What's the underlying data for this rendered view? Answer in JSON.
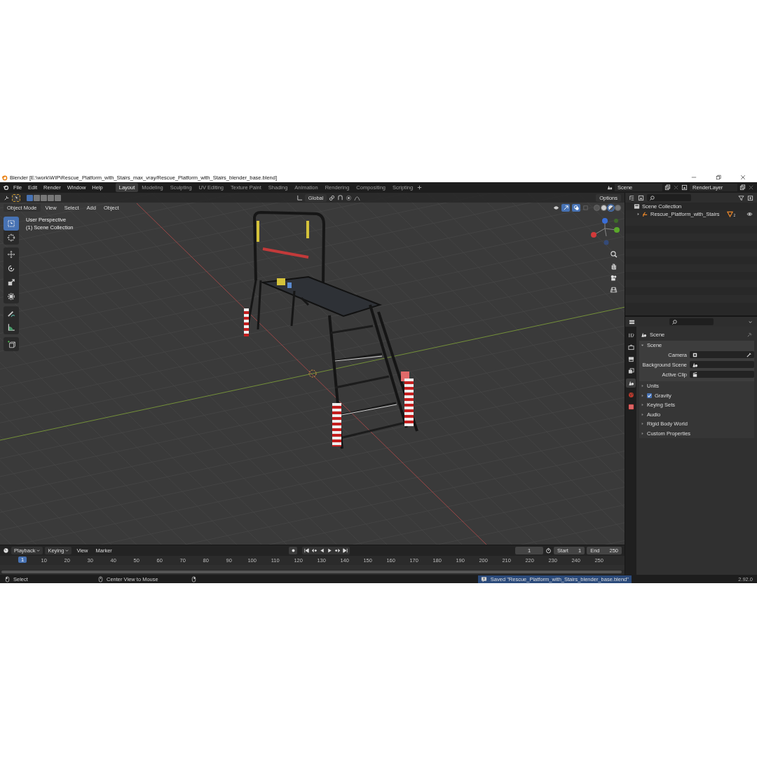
{
  "window": {
    "title": "Blender [E:\\work\\WIP\\Rescue_Platform_with_Stairs_max_vray/Rescue_Platform_with_Stairs_blender_base.blend]"
  },
  "menu": [
    "File",
    "Edit",
    "Render",
    "Window",
    "Help"
  ],
  "workspaces": [
    {
      "label": "Layout",
      "selected": true
    },
    {
      "label": "Modeling",
      "selected": false
    },
    {
      "label": "Sculpting",
      "selected": false
    },
    {
      "label": "UV Editing",
      "selected": false
    },
    {
      "label": "Texture Paint",
      "selected": false
    },
    {
      "label": "Shading",
      "selected": false
    },
    {
      "label": "Animation",
      "selected": false
    },
    {
      "label": "Rendering",
      "selected": false
    },
    {
      "label": "Compositing",
      "selected": false
    },
    {
      "label": "Scripting",
      "selected": false
    }
  ],
  "scene": "Scene",
  "view_layer": "RenderLayer",
  "viewport": {
    "orientation": "Global",
    "options": "Options",
    "mode": "Object Mode",
    "menus": [
      "View",
      "Select",
      "Add",
      "Object"
    ],
    "select_modes": [
      {
        "selected": true
      },
      {
        "selected": false
      },
      {
        "selected": false
      },
      {
        "selected": false
      },
      {
        "selected": false
      }
    ],
    "shading": [
      {
        "kind": "wireframe",
        "selected": false
      },
      {
        "kind": "solid",
        "selected": false
      },
      {
        "kind": "material",
        "selected": true
      },
      {
        "kind": "rendered",
        "selected": false
      }
    ],
    "overlay_text": [
      "User Perspective",
      "(1) Scene Collection"
    ],
    "tool_groups": [
      [
        {
          "kind": "select",
          "selected": true
        },
        {
          "kind": "cursor",
          "selected": false
        }
      ],
      [
        {
          "kind": "move",
          "selected": false
        },
        {
          "kind": "rotate",
          "selected": false
        },
        {
          "kind": "scale",
          "selected": false
        },
        {
          "kind": "transform",
          "selected": false
        }
      ],
      [
        {
          "kind": "annotate",
          "selected": false
        },
        {
          "kind": "measure",
          "selected": false
        }
      ],
      [
        {
          "kind": "add-cube",
          "selected": false
        }
      ]
    ]
  },
  "outliner": {
    "items": [
      {
        "label": "Scene Collection",
        "kind": "collection",
        "children": [
          {
            "label": "Rescue_Platform_with_Stairs",
            "kind": "object",
            "expanded": false,
            "badge": "2"
          }
        ]
      }
    ]
  },
  "properties": {
    "tabs": [
      {
        "kind": "tool",
        "selected": false
      },
      {
        "kind": "render",
        "selected": false
      },
      {
        "kind": "output",
        "selected": false
      },
      {
        "kind": "view-layer",
        "selected": false
      },
      {
        "kind": "scene",
        "selected": true
      },
      {
        "kind": "world",
        "selected": false
      },
      {
        "kind": "texture",
        "selected": false
      }
    ],
    "context": "Scene",
    "panel": {
      "title": "Scene",
      "expanded": true,
      "fields": [
        {
          "label": "Camera",
          "kind": "camera"
        },
        {
          "label": "Background Scene",
          "kind": "scene"
        },
        {
          "label": "Active Clip",
          "kind": "clip"
        }
      ]
    },
    "sections": [
      {
        "label": "Units",
        "kind": "panel"
      },
      {
        "label": "Gravity",
        "kind": "checkbox",
        "checked": true
      },
      {
        "label": "Keying Sets",
        "kind": "panel"
      },
      {
        "label": "Audio",
        "kind": "panel"
      },
      {
        "label": "Rigid Body World",
        "kind": "panel"
      },
      {
        "label": "Custom Properties",
        "kind": "panel"
      }
    ]
  },
  "timeline": {
    "menus": [
      {
        "label": "Playback",
        "dropdown": true
      },
      {
        "label": "Keying",
        "dropdown": true
      },
      {
        "label": "View",
        "dropdown": false
      },
      {
        "label": "Marker",
        "dropdown": false
      }
    ],
    "current_frame": "1",
    "start_label": "Start",
    "start": "1",
    "end_label": "End",
    "end": "250",
    "playhead": "1",
    "ticks": [
      "10",
      "20",
      "30",
      "40",
      "50",
      "60",
      "70",
      "80",
      "90",
      "100",
      "110",
      "120",
      "130",
      "140",
      "150",
      "160",
      "170",
      "180",
      "190",
      "200",
      "210",
      "220",
      "230",
      "240",
      "250"
    ]
  },
  "status_bar": {
    "hints": [
      {
        "kind": "mouse-left",
        "label": "Select"
      },
      {
        "kind": "mouse-middle",
        "label": "Center View to Mouse"
      },
      {
        "kind": "mouse-right"
      }
    ],
    "message": "Saved \"Rescue_Platform_with_Stairs_blender_base.blend\"",
    "version": "2.92.0"
  }
}
